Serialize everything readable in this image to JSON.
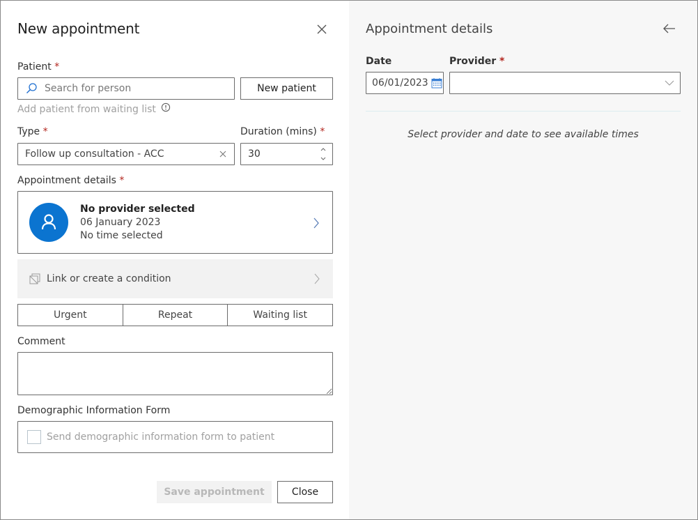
{
  "left_panel": {
    "title": "New appointment",
    "patient": {
      "label": "Patient",
      "required_mark": "*",
      "search_placeholder": "Search for person",
      "new_patient_label": "New patient",
      "waiting_list_link": "Add patient from waiting list"
    },
    "type": {
      "label": "Type",
      "required_mark": "*",
      "value": "Follow up consultation - ACC"
    },
    "duration": {
      "label": "Duration (mins)",
      "required_mark": "*",
      "value": "30"
    },
    "appointment_details": {
      "label": "Appointment details",
      "required_mark": "*",
      "provider": "No provider selected",
      "date": "06 January 2023",
      "time": "No time selected"
    },
    "condition": {
      "label": "Link or create a condition"
    },
    "flags": [
      "Urgent",
      "Repeat",
      "Waiting list"
    ],
    "comment": {
      "label": "Comment",
      "value": ""
    },
    "demographic": {
      "label": "Demographic Information Form",
      "checkbox_label": "Send demographic information form to patient",
      "checked": false
    },
    "footer": {
      "save_label": "Save appointment",
      "close_label": "Close"
    }
  },
  "right_panel": {
    "title": "Appointment details",
    "date": {
      "label": "Date",
      "value": "06/01/2023"
    },
    "provider": {
      "label": "Provider",
      "required_mark": "*",
      "value": ""
    },
    "empty_message": "Select provider and date to see available times"
  },
  "colors": {
    "accent": "#0b74d0",
    "required": "#b3261e",
    "right_panel_bg": "#f7f7f7",
    "condition_bg": "#f2f2f2"
  }
}
